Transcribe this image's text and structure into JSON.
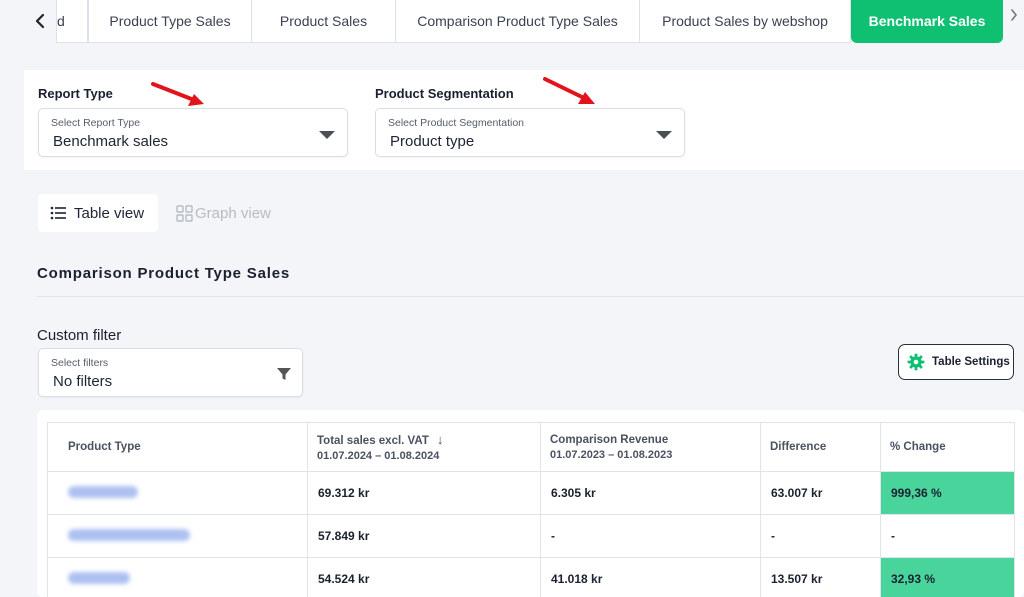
{
  "tabs": {
    "prev_icon": "chevron-left-icon",
    "next_icon": "chevron-right-icon",
    "items": [
      {
        "label": "d"
      },
      {
        "label": "Product Type Sales"
      },
      {
        "label": "Product Sales"
      },
      {
        "label": "Comparison Product Type Sales"
      },
      {
        "label": "Product Sales by webshop"
      },
      {
        "label": "Benchmark Sales",
        "active": true
      }
    ]
  },
  "filters": {
    "report_type": {
      "label": "Report Type",
      "placeholder": "Select Report Type",
      "value": "Benchmark sales"
    },
    "segmentation": {
      "label": "Product Segmentation",
      "placeholder": "Select Product Segmentation",
      "value": "Product type"
    }
  },
  "views": {
    "table": "Table view",
    "graph": "Graph view"
  },
  "section_title": "Comparison Product Type Sales",
  "custom_filter": {
    "label": "Custom filter",
    "placeholder": "Select filters",
    "value": "No filters"
  },
  "table_settings_label": "Table Settings",
  "table": {
    "headers": [
      {
        "title": "Product Type",
        "sub": ""
      },
      {
        "title": "Total sales excl. VAT",
        "sub": "01.07.2024 – 01.08.2024"
      },
      {
        "title": "Comparison Revenue",
        "sub": "01.07.2023 – 01.08.2023"
      },
      {
        "title": "Difference",
        "sub": ""
      },
      {
        "title": "% Change",
        "sub": ""
      }
    ],
    "rows": [
      {
        "total": "69.312 kr",
        "comparison": "6.305 kr",
        "difference": "63.007 kr",
        "change": "999,36 %",
        "highlight": true
      },
      {
        "total": "57.849 kr",
        "comparison": "-",
        "difference": "-",
        "change": "-",
        "highlight": false
      },
      {
        "total": "54.524 kr",
        "comparison": "41.018 kr",
        "difference": "13.507 kr",
        "change": "32,93 %",
        "highlight": true
      }
    ]
  },
  "colors": {
    "accent": "#0fbf72",
    "highlight": "#48d49b",
    "annotation_arrow": "#e3131b"
  }
}
